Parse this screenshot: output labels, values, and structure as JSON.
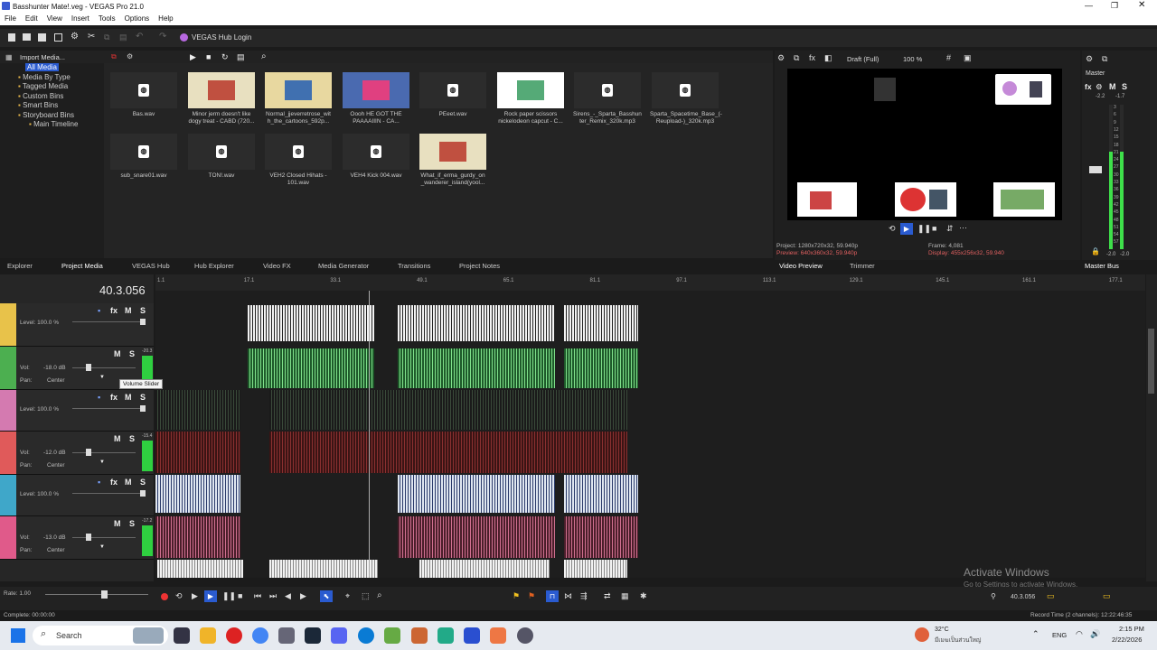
{
  "window": {
    "title": "Basshunter Mate!.veg - VEGAS Pro 21.0"
  },
  "menu": [
    "File",
    "Edit",
    "View",
    "Insert",
    "Tools",
    "Options",
    "Help"
  ],
  "toolbar": {
    "hub_login": "VEGAS Hub Login"
  },
  "media": {
    "import_label": "Import Media...",
    "tree": [
      "All Media",
      "Media By Type",
      "Tagged Media",
      "Custom Bins",
      "Smart Bins",
      "Storyboard Bins",
      "Main Timeline"
    ],
    "items": [
      {
        "name": "Bas.wav",
        "kind": "audio"
      },
      {
        "name": "Minor jerm doesn't like dogy treat - CABD (720...",
        "kind": "video"
      },
      {
        "name": "Normal_jjeverretrose_wit h_the_cartoons_592p...",
        "kind": "video"
      },
      {
        "name": "Oooh HE GOT THE PAAAAIIIN - CA...",
        "kind": "video"
      },
      {
        "name": "PEeet.wav",
        "kind": "audio"
      },
      {
        "name": "Rock paper scissors nickelodeon capcut - C...",
        "kind": "video"
      },
      {
        "name": "Sirens_-_Sparta_Basshun ter_Remix_320k.mp3",
        "kind": "audio"
      },
      {
        "name": "Sparta_Spacetime_Base_(-Reupload-)_320k.mp3",
        "kind": "audio"
      },
      {
        "name": "sub_snare01.wav",
        "kind": "audio"
      },
      {
        "name": "TON!.wav",
        "kind": "audio"
      },
      {
        "name": "VEH2 Closed Hihats - 101.wav",
        "kind": "audio"
      },
      {
        "name": "VEH4 Kick 004.wav",
        "kind": "audio"
      },
      {
        "name": "What_if_erma_gurdy_on _wanderer_island(yool...",
        "kind": "video"
      }
    ]
  },
  "preview": {
    "quality": "Draft (Full)",
    "zoom": "100 %",
    "project": "Project: 1280x720x32, 59.940p",
    "preview_line": "Preview: 640x360x32, 59.940p",
    "frame": "Frame:    4,081",
    "display": "Display:  455x256x32, 59.940",
    "tabs": [
      "Video Preview",
      "Trimmer"
    ]
  },
  "master": {
    "label": "Master",
    "scale": [
      "-2.2",
      "-1.7",
      "3",
      "6",
      "9",
      "12",
      "15",
      "18",
      "21",
      "24",
      "27",
      "30",
      "33",
      "36",
      "39",
      "42",
      "45",
      "48",
      "51",
      "54",
      "57"
    ],
    "bottom": [
      "-2.0",
      "-2.0"
    ],
    "tab": "Master Bus"
  },
  "tabs": [
    "Explorer",
    "Project Media",
    "VEGAS Hub",
    "Hub Explorer",
    "Video FX",
    "Media Generator",
    "Transitions",
    "Project Notes"
  ],
  "timeline": {
    "timecode": "40.3.056",
    "ruler": [
      "1.1",
      "17.1",
      "33.1",
      "49.1",
      "65.1",
      "81.1",
      "97.1",
      "113.1",
      "129.1",
      "145.1",
      "161.1",
      "177.1"
    ],
    "tracks": [
      {
        "type": "video",
        "color": "#e8c24a",
        "level": "Level: 100.0 %"
      },
      {
        "type": "audio",
        "color": "#4caf50",
        "vol": "-18.0 dB",
        "pan": "Center",
        "meter": "-20.3"
      },
      {
        "type": "video",
        "color": "#d47ab0",
        "level": "Level: 100.0 %"
      },
      {
        "type": "audio",
        "color": "#e05a5a",
        "vol": "-12.0 dB",
        "pan": "Center",
        "meter": "-15.4"
      },
      {
        "type": "video",
        "color": "#3fa7c9",
        "level": "Level: 100.0 %"
      },
      {
        "type": "audio",
        "color": "#e05a8a",
        "vol": "-13.0 dB",
        "pan": "Center",
        "meter": "-17.2"
      }
    ],
    "tooltip": "Volume Slider",
    "vol_label": "Vol:",
    "pan_label": "Pan:",
    "rate": "Rate: 1.00",
    "bottom_timecode": "40.3.056"
  },
  "watermark": {
    "line1": "Activate Windows",
    "line2": "Go to Settings to activate Windows."
  },
  "status": {
    "left": "Complete: 00:00:00",
    "right": "Record Time (2 channels): 12:22:46:35"
  },
  "taskbar": {
    "search": "Search",
    "weather_temp": "32°C",
    "weather_text": "มีเมฆเป็นส่วนใหญ่",
    "lang": "ENG",
    "time": "2:15 PM",
    "date": "2/22/2026"
  }
}
